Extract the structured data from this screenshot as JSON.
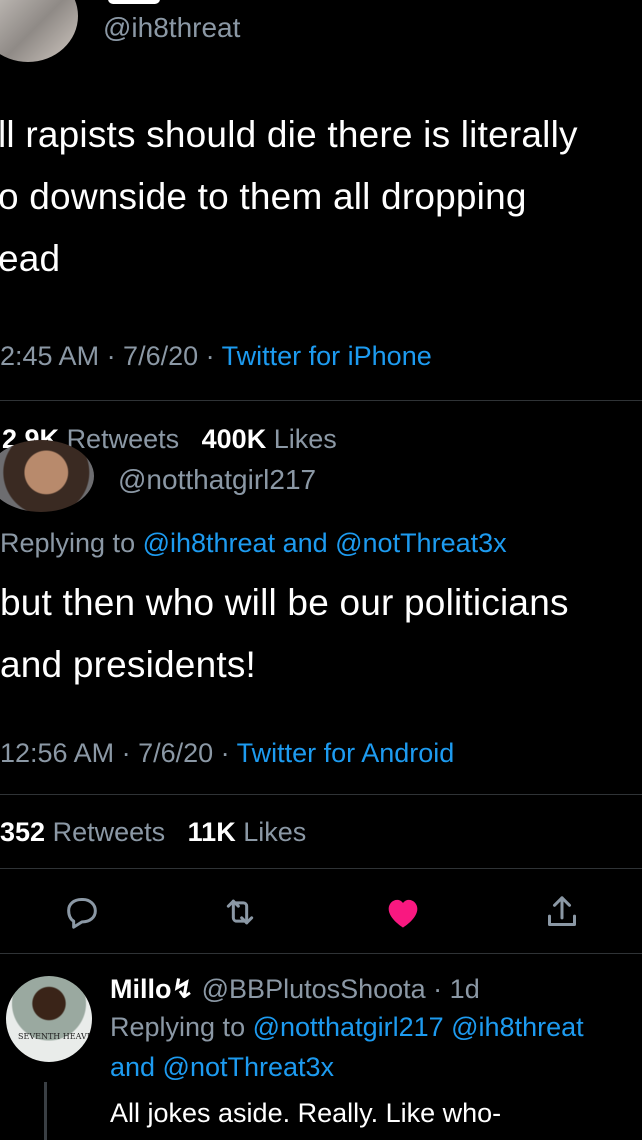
{
  "tweet1": {
    "handle": "@ih8threat",
    "text_lines": [
      "ll rapists should die there is literally",
      "o downside to them all dropping",
      "ead"
    ],
    "time_date": "2:45 AM · 7/6/20 · ",
    "source": "Twitter for iPhone",
    "retweets_count": "2.9K",
    "retweets_label": "Retweets",
    "likes_count": "400K",
    "likes_label": "Likes"
  },
  "tweet2": {
    "handle": "@notthatgirl217",
    "replying_prefix": "Replying to ",
    "replying_to": "@ih8threat and @notThreat3x",
    "text_lines": [
      "but then who will be our politicians",
      "and presidents!"
    ],
    "time_date": "12:56 AM · 7/6/20 · ",
    "source": "Twitter for Android",
    "retweets_count": "352",
    "retweets_label": "Retweets",
    "likes_count": "11K",
    "likes_label": "Likes",
    "liked": true
  },
  "reply": {
    "name": "Millo",
    "name_symbol": "↯",
    "handle_time": "@BBPlutosShoota · 1d",
    "replying_prefix": "Replying to ",
    "replying_to_line1": "@notthatgirl217 @ih8threat",
    "replying_to_line2": "and @notThreat3x",
    "text": "All jokes aside. Really. Like who-",
    "avatar_shirt_text": "SEVENTH HEAVE"
  },
  "icons": [
    "reply-icon",
    "retweet-icon",
    "heart-icon",
    "share-icon"
  ],
  "colors": {
    "background": "#000000",
    "link": "#1d9bf0",
    "secondary": "#8b98a5",
    "like": "#f91880"
  }
}
